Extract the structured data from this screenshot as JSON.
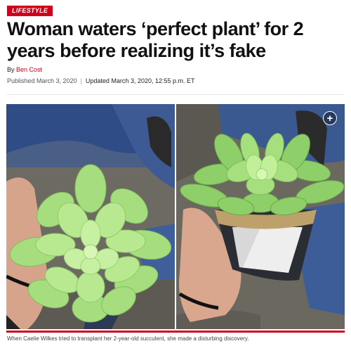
{
  "article": {
    "category": "LIFESTYLE",
    "headline": "Woman waters ‘perfect plant’ for 2 years before realizing it’s fake",
    "byline_prefix": "By",
    "author": "Ben Cost",
    "published": "Published March 3, 2020",
    "separator": "|",
    "updated": "Updated March 3, 2020, 12:55 p.m. ET"
  },
  "gallery": {
    "expand_icon": "plus-icon",
    "expand_glyph": "+",
    "caption": "When Caelie Wilkes tried to transplant her 2-year-old succulent, she made a disturbing discovery."
  },
  "colors": {
    "accent": "#d0021b",
    "plant_green": "#9ed86f",
    "denim": "#3b5d9a"
  }
}
